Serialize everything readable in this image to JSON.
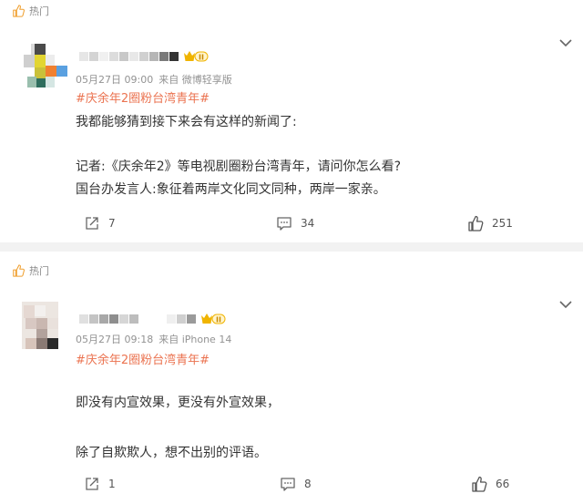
{
  "posts": [
    {
      "hot_label": "热门",
      "meta": {
        "date": "05月27日 09:00",
        "source": "来自 微博轻享版"
      },
      "tag": "#庆余年2圈粉台湾青年#",
      "lines": [
        "我都能够猜到接下来会有这样的新闻了:",
        "记者:《庆余年2》等电视剧圈粉台湾青年，请问你怎么看?",
        "国台办发言人:象征着两岸文化同文同种，两岸一家亲。"
      ],
      "counts": {
        "repost": "7",
        "comment": "34",
        "like": "251"
      },
      "badge_text": "II"
    },
    {
      "hot_label": "热门",
      "meta": {
        "date": "05月27日 09:18",
        "source": "来自 iPhone 14"
      },
      "tag": "#庆余年2圈粉台湾青年#",
      "lines": [
        "即没有内宣效果，更没有外宣效果，",
        "除了自欺欺人，想不出别的评语。"
      ],
      "counts": {
        "repost": "1",
        "comment": "8",
        "like": "66"
      },
      "badge_text": "II"
    }
  ],
  "colors": {
    "tag": "#eb7350",
    "badge": "#f0b400",
    "background": "#f2f2f2"
  },
  "icons": [
    "like-icon",
    "chevron-down-icon",
    "repost-icon",
    "comment-icon",
    "vip-badge-icon"
  ]
}
